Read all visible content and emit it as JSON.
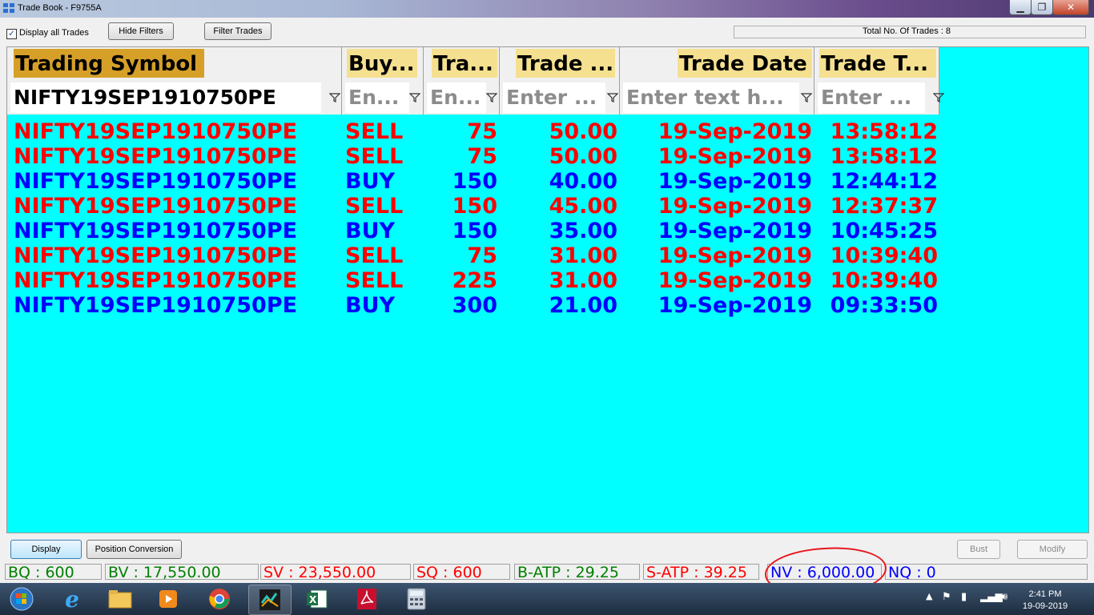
{
  "window": {
    "title": "Trade Book - F9755A"
  },
  "toolbar": {
    "display_all_label": "Display all Trades",
    "display_all_checked": true,
    "hide_filters_label": "Hide Filters",
    "filter_trades_label": "Filter Trades",
    "total_trades_text": "Total No. Of Trades : 8"
  },
  "grid": {
    "columns": [
      "Trading Symbol",
      "Buy...",
      "Tra...",
      "Trade ...",
      "Trade Date",
      "Trade T..."
    ],
    "filters": [
      "NIFTY19SEP1910750PE",
      "En...",
      "En...",
      "Enter ...",
      "Enter text h...",
      "Enter ..."
    ],
    "rows": [
      {
        "symbol": "NIFTY19SEP1910750PE",
        "side": "SELL",
        "qty": "75",
        "price": "50.00",
        "date": "19-Sep-2019",
        "time": "13:58:12"
      },
      {
        "symbol": "NIFTY19SEP1910750PE",
        "side": "SELL",
        "qty": "75",
        "price": "50.00",
        "date": "19-Sep-2019",
        "time": "13:58:12"
      },
      {
        "symbol": "NIFTY19SEP1910750PE",
        "side": "BUY",
        "qty": "150",
        "price": "40.00",
        "date": "19-Sep-2019",
        "time": "12:44:12"
      },
      {
        "symbol": "NIFTY19SEP1910750PE",
        "side": "SELL",
        "qty": "150",
        "price": "45.00",
        "date": "19-Sep-2019",
        "time": "12:37:37"
      },
      {
        "symbol": "NIFTY19SEP1910750PE",
        "side": "BUY",
        "qty": "150",
        "price": "35.00",
        "date": "19-Sep-2019",
        "time": "10:45:25"
      },
      {
        "symbol": "NIFTY19SEP1910750PE",
        "side": "SELL",
        "qty": "75",
        "price": "31.00",
        "date": "19-Sep-2019",
        "time": "10:39:40"
      },
      {
        "symbol": "NIFTY19SEP1910750PE",
        "side": "SELL",
        "qty": "225",
        "price": "31.00",
        "date": "19-Sep-2019",
        "time": "10:39:40"
      },
      {
        "symbol": "NIFTY19SEP1910750PE",
        "side": "BUY",
        "qty": "300",
        "price": "21.00",
        "date": "19-Sep-2019",
        "time": "09:33:50"
      }
    ]
  },
  "actions": {
    "display_label": "Display",
    "position_conversion_label": "Position Conversion",
    "bust_label": "Bust",
    "modify_label": "Modify"
  },
  "status": {
    "bq": "BQ : 600",
    "bv": "BV : 17,550.00",
    "sv": "SV : 23,550.00",
    "sq": "SQ : 600",
    "batp": "B-ATP : 29.25",
    "satp": "S-ATP : 39.25",
    "nv": "NV : 6,000.00",
    "nq": "NQ : 0"
  },
  "colors": {
    "grid_bg": "#00ffff",
    "sell": "#ff0000",
    "buy": "#0000ff",
    "header_first": "#d6a028",
    "header": "#f5e090",
    "annotation": "#e8141c"
  },
  "taskbar": {
    "icons": [
      "windows-start",
      "internet-explorer",
      "file-explorer",
      "media-player",
      "chrome",
      "trading-terminal",
      "excel",
      "acrobat-reader",
      "calculator"
    ],
    "time": "2:41 PM",
    "date": "19-09-2019"
  }
}
